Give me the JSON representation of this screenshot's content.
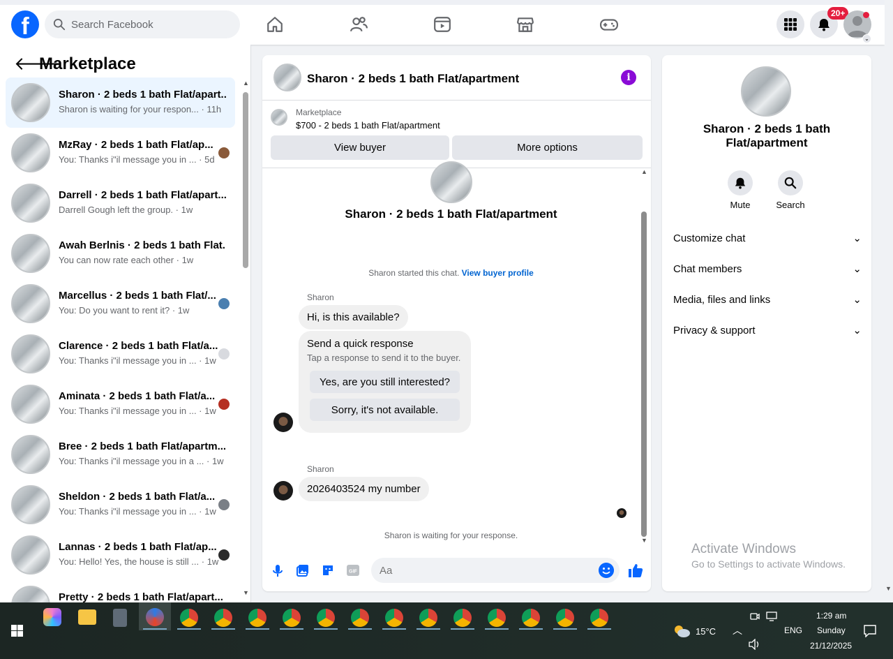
{
  "header": {
    "search_placeholder": "Search Facebook",
    "notification_badge": "20+",
    "nav_icons": [
      "home-icon",
      "friends-icon",
      "watch-icon",
      "marketplace-icon",
      "gaming-icon"
    ]
  },
  "left": {
    "title": "Marketplace",
    "conversations": [
      {
        "title": "Sharon · 2 beds 1 bath Flat/apart...",
        "preview": "Sharon is waiting for your respon... · 11h",
        "active": true
      },
      {
        "title": "MzRay · 2 beds 1 bath Flat/ap...",
        "preview": "You: Thanks i\"il message you in ... · 5d",
        "avatar_color": "#8a5a3a"
      },
      {
        "title": "Darrell · 2 beds 1 bath Flat/apart...",
        "preview": "Darrell Gough left the group. · 1w"
      },
      {
        "title": "Awah Berlnis · 2 beds 1 bath Flat...",
        "preview": "You can now rate each other · 1w"
      },
      {
        "title": "Marcellus · 2 beds 1 bath Flat/...",
        "preview": "You: Do you want to rent it? · 1w",
        "avatar_color": "#4a7fb0"
      },
      {
        "title": "Clarence · 2 beds 1 bath Flat/a...",
        "preview": "You: Thanks i\"il message you in ... · 1w",
        "avatar_color": "#d8dadf"
      },
      {
        "title": "Aminata · 2 beds 1 bath Flat/a...",
        "preview": "You: Thanks i\"il message you in ... · 1w",
        "avatar_color": "#b52f22"
      },
      {
        "title": "Bree · 2 beds 1 bath Flat/apartm...",
        "preview": "You: Thanks i\"il message you in a ... · 1w"
      },
      {
        "title": "Sheldon · 2 beds 1 bath Flat/a...",
        "preview": "You: Thanks i\"il message you in ... · 1w",
        "avatar_color": "#7a7f86"
      },
      {
        "title": "Lannas · 2 beds 1 bath Flat/ap...",
        "preview": "You: Hello! Yes, the house is still ... · 1w",
        "avatar_color": "#2b2b2b"
      },
      {
        "title": "Pretty · 2 beds 1 bath Flat/apart...",
        "preview": ""
      }
    ]
  },
  "chat": {
    "title": "Sharon · 2 beds 1 bath Flat/apartment",
    "marketplace_label": "Marketplace",
    "listing": "$700 - 2 beds 1 bath Flat/apartment",
    "view_buyer": "View buyer",
    "more_options": "More options",
    "big_name": "Sharon · 2 beds 1 bath Flat/apartment",
    "started_text": "Sharon started this chat.",
    "view_profile": "View buyer profile",
    "sender": "Sharon",
    "msg1": "Hi, is this available?",
    "quick_title": "Send a quick response",
    "quick_sub": "Tap a response to send it to the buyer.",
    "quick_opt1": "Yes, are you still interested?",
    "quick_opt2": "Sorry, it's not available.",
    "sender2": "Sharon",
    "msg2": "2026403524 my number",
    "waiting": "Sharon is waiting for your response.",
    "compose_placeholder": "Aa",
    "compose_icons": [
      "microphone-icon",
      "photo-icon",
      "sticker-icon",
      "gif-icon",
      "emoji-icon",
      "like-icon"
    ]
  },
  "right": {
    "name": "Sharon · 2 beds 1 bath Flat/apartment",
    "mute": "Mute",
    "search": "Search",
    "rows": [
      "Customize chat",
      "Chat members",
      "Media, files and links",
      "Privacy & support"
    ]
  },
  "watermark": {
    "line1": "Activate Windows",
    "line2": "Go to Settings to activate Windows."
  },
  "taskbar": {
    "temperature": "15°C",
    "language": "ENG",
    "time": "1:29 am",
    "day": "Sunday",
    "date": "21/12/2025"
  },
  "colors": {
    "facebook_blue": "#0866ff",
    "info_purple": "#8a0bd6",
    "link_blue": "#0064d1",
    "badge_red": "#e41e3f"
  }
}
